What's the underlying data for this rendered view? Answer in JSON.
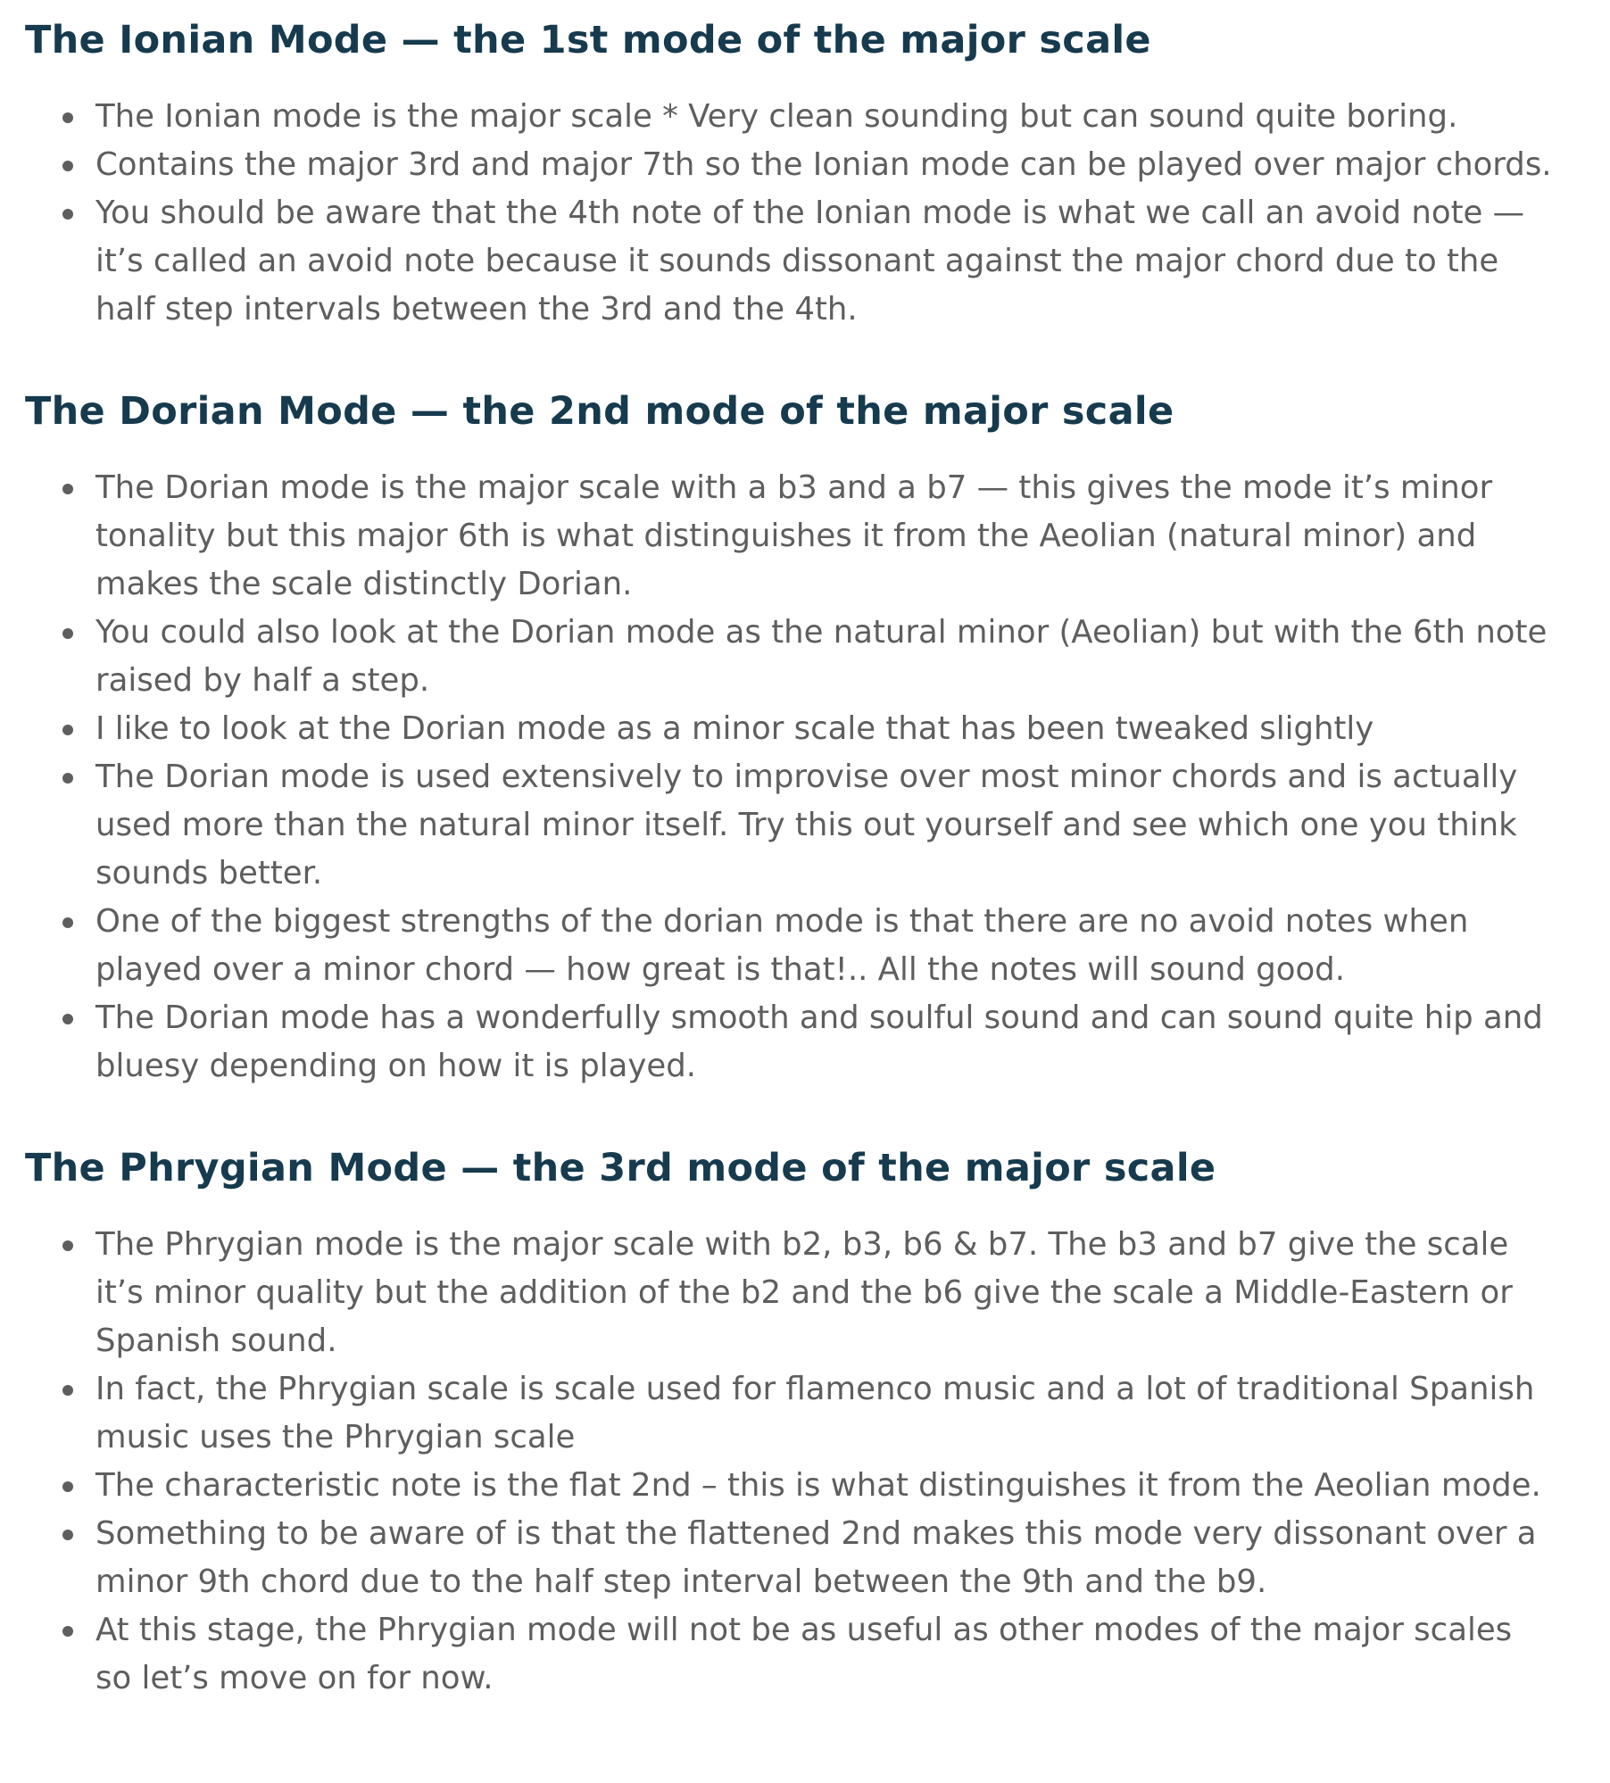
{
  "sections": [
    {
      "heading": "The Ionian Mode — the 1st mode of the major scale",
      "items": [
        "The Ionian mode is the major scale * Very clean sounding but can sound quite boring.",
        "Contains the major 3rd and major 7th so the Ionian mode can be played over major chords.",
        "You should be aware that the 4th note of the Ionian mode is what we call an avoid note — it’s called an avoid note because it sounds dissonant against the major chord due to the half step intervals between the 3rd and the 4th."
      ]
    },
    {
      "heading": "The Dorian Mode — the 2nd mode of the major scale",
      "items": [
        "The Dorian mode is the major scale with a b3 and a b7 — this gives the mode it’s minor tonality but this major 6th is what distinguishes it from the Aeolian (natural minor) and makes the scale distinctly Dorian.",
        "You could also look at the Dorian mode as the natural minor (Aeolian) but with the 6th note raised by half a step.",
        "I like to look at the Dorian mode as a minor scale that has been tweaked slightly",
        "The Dorian mode is used extensively to improvise over most minor chords and is actually used more than the natural minor itself. Try this out yourself and see which one you think sounds better.",
        "One of the biggest strengths of the dorian mode is that there are no avoid notes when played over a minor chord — how great is that!.. All the notes will sound good.",
        "The Dorian mode has a wonderfully smooth and soulful sound and can sound quite hip and bluesy depending on how it is played."
      ]
    },
    {
      "heading": "The Phrygian Mode — the 3rd mode of the major scale",
      "items": [
        "The Phrygian mode is the major scale with b2, b3, b6 & b7. The b3 and b7 give the scale it’s minor quality but the addition of the b2 and the b6 give the scale a Middle-Eastern or Spanish sound.",
        "In fact, the Phrygian scale is scale used for flamenco music and a lot of traditional Spanish music uses the Phrygian scale",
        "The characteristic note is the flat 2nd – this is what distinguishes it from the Aeolian mode.",
        "Something to be aware of is that the flattened 2nd makes this mode very dissonant over a minor 9th chord due to the half step interval between the 9th and the b9.",
        "At this stage, the Phrygian mode will not be as useful as other modes of the major scales so let’s move on for now."
      ]
    }
  ]
}
